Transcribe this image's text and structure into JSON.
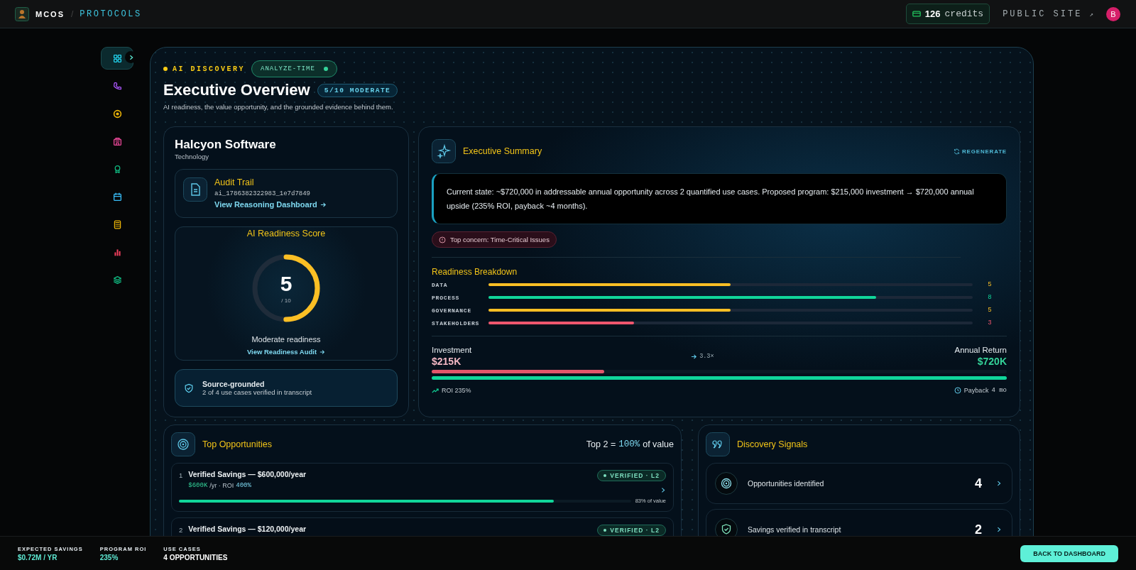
{
  "header": {
    "brand": "MCOS",
    "separator": "/",
    "section": "PROTOCOLS",
    "credits_count": "126",
    "credits_label": "credits",
    "public_site": "PUBLIC SITE",
    "public_site_icon": "↗",
    "avatar": "B"
  },
  "sidebar": {
    "items": [
      {
        "kind": "grid",
        "color": "#22d3ee",
        "selected": true
      },
      {
        "kind": "phone",
        "color": "#a855f7",
        "selected": false
      },
      {
        "kind": "target",
        "color": "#eab308",
        "selected": false
      },
      {
        "kind": "building",
        "color": "#ec4899",
        "selected": false
      },
      {
        "kind": "award",
        "color": "#10b981",
        "selected": false
      },
      {
        "kind": "calendar",
        "color": "#38bdf8",
        "selected": false
      },
      {
        "kind": "calculator",
        "color": "#eab308",
        "selected": false
      },
      {
        "kind": "chart",
        "color": "#f43f5e",
        "selected": false
      },
      {
        "kind": "layers",
        "color": "#10b981",
        "selected": false
      }
    ]
  },
  "page": {
    "eyebrow": "AI DISCOVERY",
    "mode_badge": "ANALYZE-TIME",
    "title": "Executive Overview",
    "score_badge": "5/10 MODERATE",
    "subtitle": "AI readiness, the value opportunity, and the grounded evidence behind them."
  },
  "company": {
    "name": "Halcyon Software",
    "industry": "Technology"
  },
  "audit": {
    "title": "Audit Trail",
    "id": "ai_1786382322983_1e7d7849",
    "link": "View Reasoning Dashboard"
  },
  "readiness": {
    "title": "AI Readiness Score",
    "score": "5",
    "out_of": "/ 10",
    "level": 0.5,
    "label": "Moderate readiness",
    "link": "View Readiness Audit"
  },
  "grounded": {
    "title": "Source-grounded",
    "detail": "2 of 4 use cases verified in transcript"
  },
  "summary": {
    "title": "Executive Summary",
    "action": "REGENERATE",
    "text": "Current state: ~$720,000 in addressable annual opportunity across 2 quantified use cases. Proposed program: $215,000 investment → $720,000 annual upside (235% ROI, payback ~4 months).",
    "concern": "Top concern: Time-Critical Issues"
  },
  "breakdown": {
    "title": "Readiness Breakdown",
    "rows": [
      {
        "label": "DATA",
        "value": "5",
        "level": 0.5,
        "color": "#fbbf24"
      },
      {
        "label": "PROCESS",
        "value": "8",
        "level": 0.8,
        "color": "#10d69a"
      },
      {
        "label": "GOVERNANCE",
        "value": "5",
        "level": 0.5,
        "color": "#fbbf24"
      },
      {
        "label": "STAKEHOLDERS",
        "value": "3",
        "level": 0.3,
        "color": "#f0566e"
      }
    ]
  },
  "investment": {
    "label": "Investment",
    "amount": "$215K",
    "multiple": "3.3×",
    "return_label": "Annual Return",
    "return_amount": "$720K",
    "investment_bar": {
      "level": 0.3
    },
    "return_bar": {
      "level": 1
    },
    "roi": "ROI 235%",
    "payback_label": "Payback",
    "payback_value": "4 mo"
  },
  "opportunities": {
    "title": "Top Opportunities",
    "summary_prefix": "Top 2 =",
    "summary_value": "100%",
    "summary_suffix": "of value",
    "items": [
      {
        "rank": "1",
        "title": "Verified Savings — $600,000/year",
        "amount": "$600K",
        "detail": "/yr · ROI",
        "roi": "400%",
        "badge": "VERIFIED · L2",
        "level": 0.83,
        "share": "83% of value"
      },
      {
        "rank": "2",
        "title": "Verified Savings — $120,000/year",
        "badge": "VERIFIED · L2"
      }
    ]
  },
  "signals": {
    "title": "Discovery Signals",
    "items": [
      {
        "kind": "target",
        "label": "Opportunities identified",
        "count": "4"
      },
      {
        "kind": "shield",
        "label": "Savings verified in transcript",
        "count": "2"
      }
    ]
  },
  "footer": {
    "stats": [
      {
        "label": "EXPECTED SAVINGS",
        "value": "$0.72M / YR",
        "color": "#5eead4"
      },
      {
        "label": "PROGRAM ROI",
        "value": "235%",
        "color": "#5eead4"
      },
      {
        "label": "USE CASES",
        "value": "4 OPPORTUNITIES",
        "color": "#ffffff"
      }
    ],
    "button": "BACK TO DASHBOARD"
  }
}
